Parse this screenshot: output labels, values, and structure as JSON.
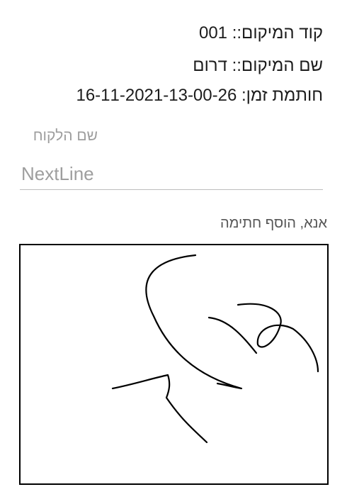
{
  "location_code_line": "קוד המיקום:: 001",
  "location_name_line": "שם המיקום:: דרום",
  "timestamp_line": "חותמת זמן: 16-11-2021-13-00-26",
  "customer_field": {
    "label": "שם הלקוח",
    "value": "NextLine"
  },
  "signature": {
    "prompt": "אנא, הוסף חתימה"
  }
}
